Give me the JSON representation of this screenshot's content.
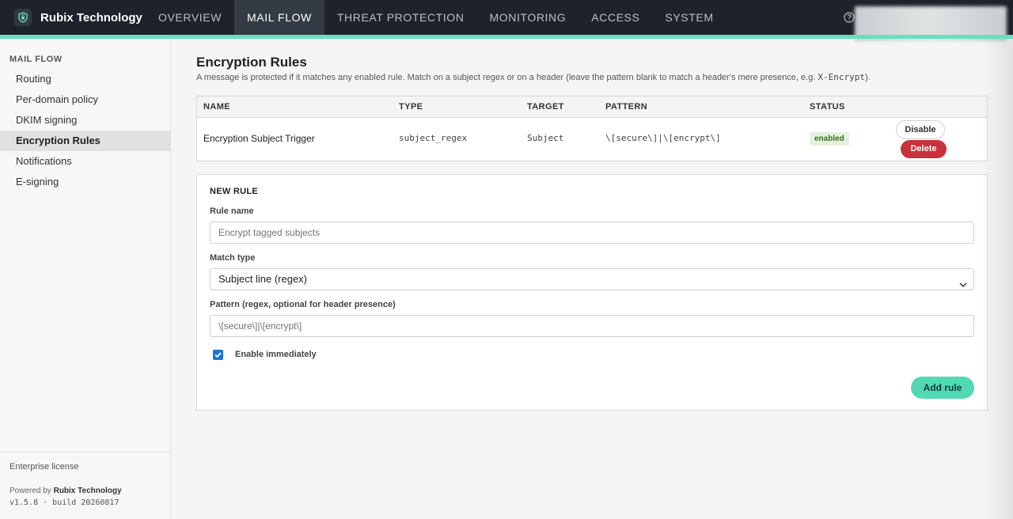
{
  "app": {
    "brand_name": "Rubix Technology",
    "accent_color": "#6fdcc0",
    "nav_tabs": [
      {
        "label": "OVERVIEW",
        "active": false
      },
      {
        "label": "MAIL FLOW",
        "active": true
      },
      {
        "label": "THREAT PROTECTION",
        "active": false
      },
      {
        "label": "MONITORING",
        "active": false
      },
      {
        "label": "ACCESS",
        "active": false
      },
      {
        "label": "SYSTEM",
        "active": false
      }
    ],
    "help_icon": "question-circle-icon"
  },
  "sidebar": {
    "heading": "MAIL FLOW",
    "items": [
      {
        "label": "Routing",
        "active": false
      },
      {
        "label": "Per-domain policy",
        "active": false
      },
      {
        "label": "DKIM signing",
        "active": false
      },
      {
        "label": "Encryption Rules",
        "active": true
      },
      {
        "label": "Notifications",
        "active": false
      },
      {
        "label": "E-signing",
        "active": false
      }
    ],
    "license": "Enterprise license",
    "powered_by_prefix": "Powered by",
    "powered_by_name": "Rubix Technology",
    "version": "v1.5.8 · build 20260817"
  },
  "page": {
    "title": "Encryption Rules",
    "description": "A message is protected if it matches any enabled rule. Match on a subject regex or on a header (leave the pattern blank to match a header's mere presence, e.g.",
    "description_code": "X-Encrypt",
    "description_end": ")."
  },
  "rules_table": {
    "columns": [
      "NAME",
      "TYPE",
      "TARGET",
      "PATTERN",
      "STATUS"
    ],
    "rows": [
      {
        "name": "Encryption Subject Trigger",
        "type": "subject_regex",
        "target": "Subject",
        "pattern": "\\[secure\\]|\\[encrypt\\]",
        "status": "enabled",
        "disable_label": "Disable",
        "delete_label": "Delete"
      }
    ]
  },
  "new_rule": {
    "heading": "NEW RULE",
    "name_label": "Rule name",
    "name_placeholder": "Encrypt tagged subjects",
    "match_label": "Match type",
    "match_value": "Subject line (regex)",
    "pattern_label": "Pattern (regex, optional for header presence)",
    "pattern_placeholder": "\\[secure\\]|\\[encrypt\\]",
    "enable_checked": true,
    "enable_label": "Enable immediately",
    "add_label": "Add rule"
  },
  "colors": {
    "topbar": "#1d222b",
    "danger": "#c8323a",
    "primary": "#52d8b3",
    "status_enabled_bg": "#e5f1dd"
  }
}
